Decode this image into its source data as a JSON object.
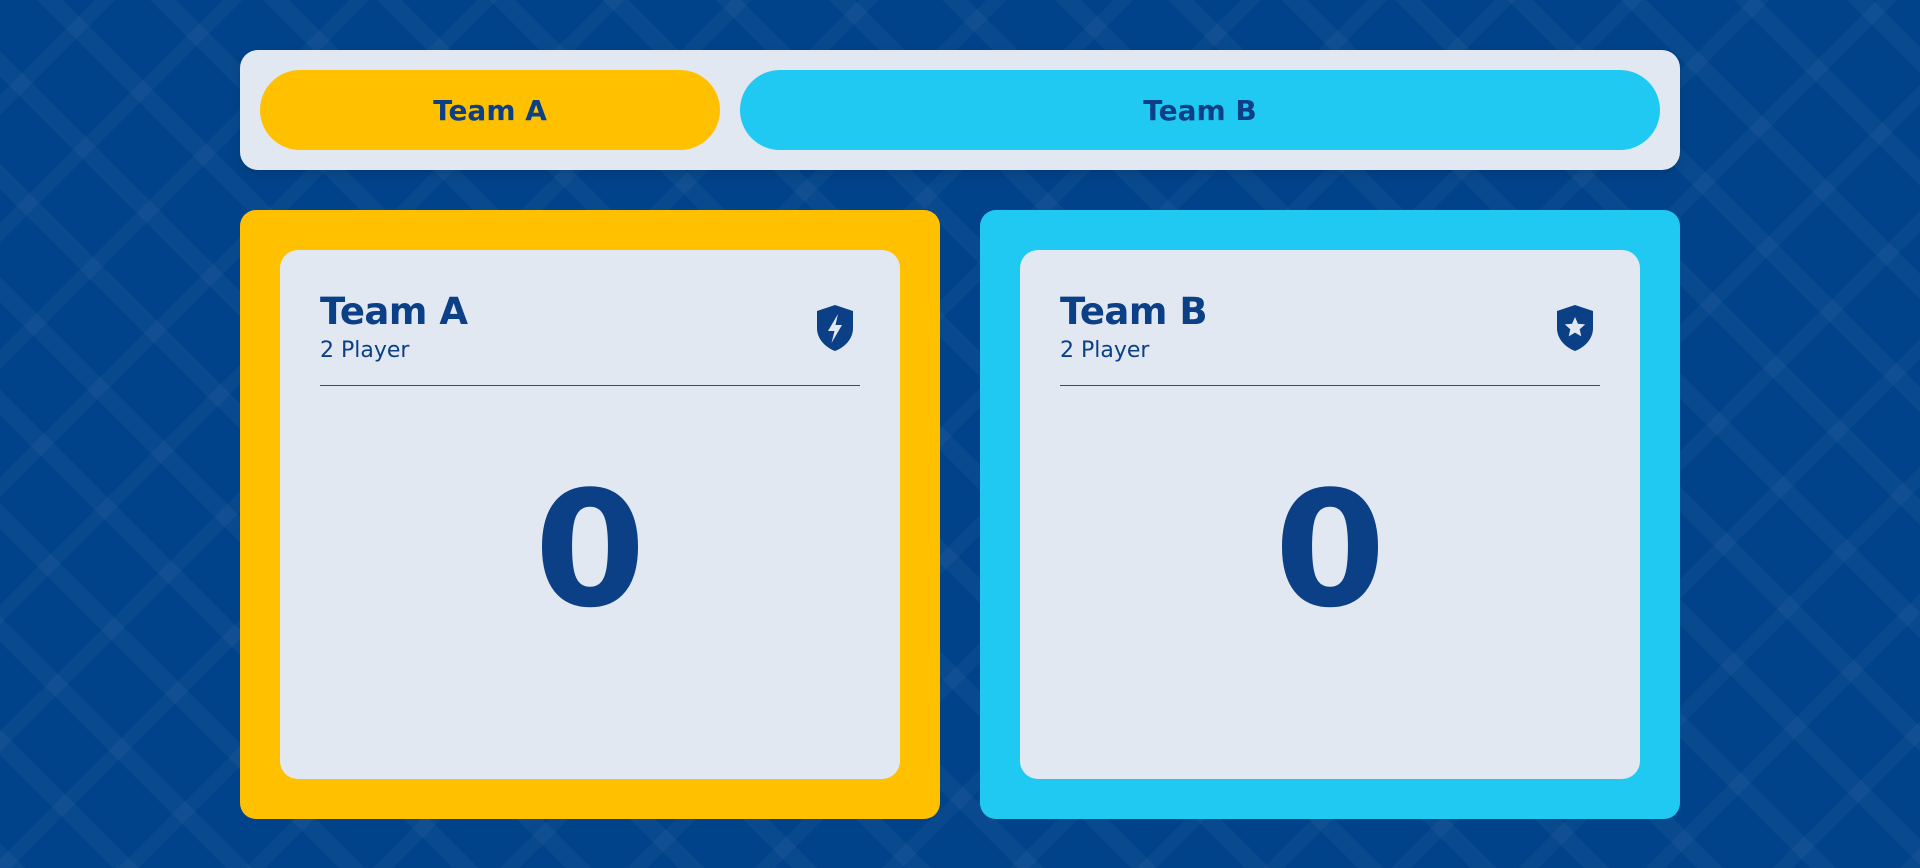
{
  "colors": {
    "background": "#00438a",
    "team_a": "#ffc000",
    "team_b": "#1fc9f2",
    "text": "#0b3f86",
    "card": "#e1e8f1"
  },
  "tabs": [
    {
      "label": "Team A",
      "color": "#ffc000",
      "icon": "none"
    },
    {
      "label": "Team B",
      "color": "#1fc9f2",
      "icon": "none"
    }
  ],
  "teams": [
    {
      "name": "Team A",
      "players": "2 Player",
      "score": "0",
      "color": "#ffc000",
      "icon": "shield-lightning-icon"
    },
    {
      "name": "Team B",
      "players": "2 Player",
      "score": "0",
      "color": "#1fc9f2",
      "icon": "shield-star-icon"
    }
  ]
}
